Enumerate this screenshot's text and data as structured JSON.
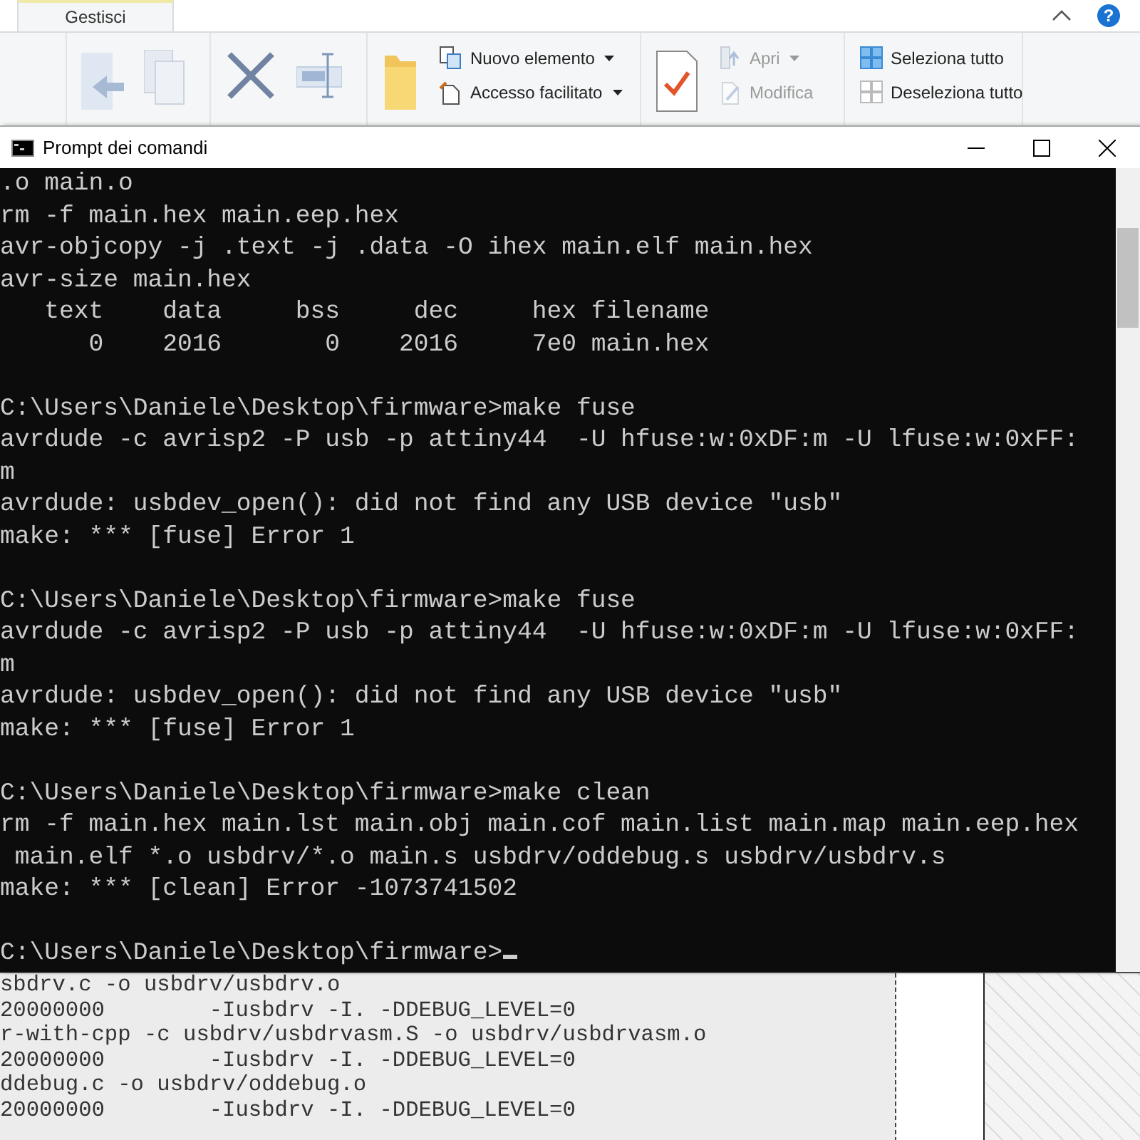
{
  "ribbon": {
    "tabs": [
      {
        "label": "Gestisci",
        "selected": true
      }
    ],
    "help_button": "?",
    "commands": [
      {
        "label": "Nuovo elemento",
        "disabled": false,
        "dropdown": true
      },
      {
        "label": "Accesso facilitato",
        "disabled": false,
        "dropdown": true
      },
      {
        "label": "Apri",
        "disabled": true,
        "dropdown": true
      },
      {
        "label": "Modifica",
        "disabled": true,
        "dropdown": false
      },
      {
        "label": "Seleziona tutto",
        "disabled": false,
        "dropdown": false
      },
      {
        "label": "Deseleziona tutto",
        "disabled": false,
        "dropdown": false
      }
    ]
  },
  "console": {
    "title": "Prompt dei comandi",
    "blocks": [
      [
        ".o main.o",
        "rm -f main.hex main.eep.hex",
        "avr-objcopy -j .text -j .data -O ihex main.elf main.hex",
        "avr-size main.hex",
        "   text    data     bss     dec     hex filename",
        "      0    2016       0    2016     7e0 main.hex"
      ],
      [
        "C:\\Users\\Daniele\\Desktop\\firmware>make fuse",
        "avrdude -c avrisp2 -P usb -p attiny44  -U hfuse:w:0xDF:m -U lfuse:w:0xFF:",
        "m",
        "avrdude: usbdev_open(): did not find any USB device \"usb\"",
        "make: *** [fuse] Error 1"
      ],
      [
        "C:\\Users\\Daniele\\Desktop\\firmware>make fuse",
        "avrdude -c avrisp2 -P usb -p attiny44  -U hfuse:w:0xDF:m -U lfuse:w:0xFF:",
        "m",
        "avrdude: usbdev_open(): did not find any USB device \"usb\"",
        "make: *** [fuse] Error 1"
      ],
      [
        "C:\\Users\\Daniele\\Desktop\\firmware>make clean",
        "rm -f main.hex main.lst main.obj main.cof main.list main.map main.eep.hex",
        " main.elf *.o usbdrv/*.o main.s usbdrv/oddebug.s usbdrv/usbdrv.s",
        "make: *** [clean] Error -1073741502"
      ],
      [
        "C:\\Users\\Daniele\\Desktop\\firmware>"
      ]
    ]
  },
  "background_log": [
    "sbdrv.c -o usbdrv/usbdrv.o",
    "20000000        -Iusbdrv -I. -DDEBUG_LEVEL=0",
    "r-with-cpp -c usbdrv/usbdrvasm.S -o usbdrv/usbdrvasm.o",
    "20000000        -Iusbdrv -I. -DDEBUG_LEVEL=0",
    "ddebug.c -o usbdrv/oddebug.o",
    "20000000        -Iusbdrv -I. -DDEBUG_LEVEL=0"
  ]
}
